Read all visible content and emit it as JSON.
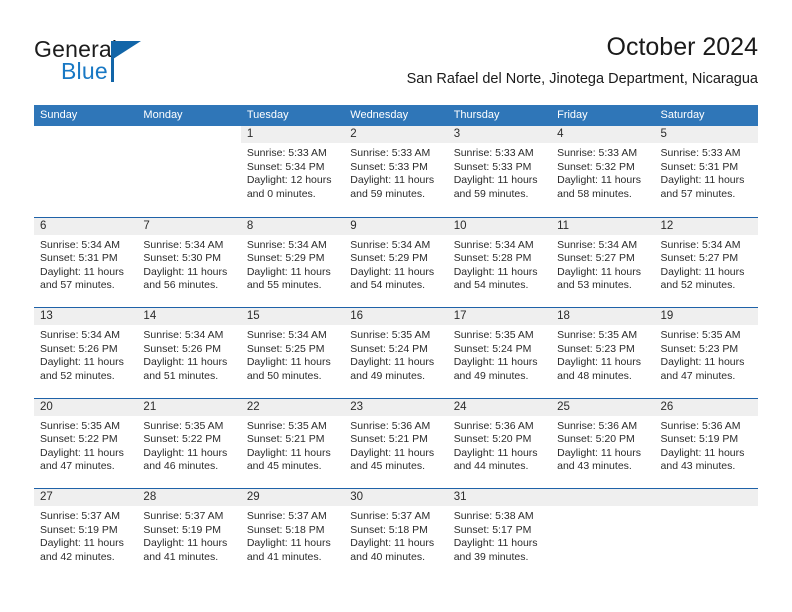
{
  "brand": {
    "word_one": "General",
    "word_two": "Blue",
    "accent_color": "#1265a8",
    "blue_text_color": "#1878c4"
  },
  "header": {
    "title": "October 2024",
    "subtitle": "San Rafael del Norte, Jinotega Department, Nicaragua"
  },
  "calendar": {
    "header_bg": "#2f76b8",
    "daynum_bg": "#efefef",
    "separator_color": "#1f62a8",
    "weekdays": [
      "Sunday",
      "Monday",
      "Tuesday",
      "Wednesday",
      "Thursday",
      "Friday",
      "Saturday"
    ],
    "weeks": [
      [
        {
          "day": "",
          "empty": true,
          "blank": true,
          "lines": []
        },
        {
          "day": "",
          "empty": true,
          "blank": true,
          "lines": []
        },
        {
          "day": "1",
          "lines": [
            "Sunrise: 5:33 AM",
            "Sunset: 5:34 PM",
            "Daylight: 12 hours",
            "and 0 minutes."
          ]
        },
        {
          "day": "2",
          "lines": [
            "Sunrise: 5:33 AM",
            "Sunset: 5:33 PM",
            "Daylight: 11 hours",
            "and 59 minutes."
          ]
        },
        {
          "day": "3",
          "lines": [
            "Sunrise: 5:33 AM",
            "Sunset: 5:33 PM",
            "Daylight: 11 hours",
            "and 59 minutes."
          ]
        },
        {
          "day": "4",
          "lines": [
            "Sunrise: 5:33 AM",
            "Sunset: 5:32 PM",
            "Daylight: 11 hours",
            "and 58 minutes."
          ]
        },
        {
          "day": "5",
          "lines": [
            "Sunrise: 5:33 AM",
            "Sunset: 5:31 PM",
            "Daylight: 11 hours",
            "and 57 minutes."
          ]
        }
      ],
      [
        {
          "day": "6",
          "lines": [
            "Sunrise: 5:34 AM",
            "Sunset: 5:31 PM",
            "Daylight: 11 hours",
            "and 57 minutes."
          ]
        },
        {
          "day": "7",
          "lines": [
            "Sunrise: 5:34 AM",
            "Sunset: 5:30 PM",
            "Daylight: 11 hours",
            "and 56 minutes."
          ]
        },
        {
          "day": "8",
          "lines": [
            "Sunrise: 5:34 AM",
            "Sunset: 5:29 PM",
            "Daylight: 11 hours",
            "and 55 minutes."
          ]
        },
        {
          "day": "9",
          "lines": [
            "Sunrise: 5:34 AM",
            "Sunset: 5:29 PM",
            "Daylight: 11 hours",
            "and 54 minutes."
          ]
        },
        {
          "day": "10",
          "lines": [
            "Sunrise: 5:34 AM",
            "Sunset: 5:28 PM",
            "Daylight: 11 hours",
            "and 54 minutes."
          ]
        },
        {
          "day": "11",
          "lines": [
            "Sunrise: 5:34 AM",
            "Sunset: 5:27 PM",
            "Daylight: 11 hours",
            "and 53 minutes."
          ]
        },
        {
          "day": "12",
          "lines": [
            "Sunrise: 5:34 AM",
            "Sunset: 5:27 PM",
            "Daylight: 11 hours",
            "and 52 minutes."
          ]
        }
      ],
      [
        {
          "day": "13",
          "lines": [
            "Sunrise: 5:34 AM",
            "Sunset: 5:26 PM",
            "Daylight: 11 hours",
            "and 52 minutes."
          ]
        },
        {
          "day": "14",
          "lines": [
            "Sunrise: 5:34 AM",
            "Sunset: 5:26 PM",
            "Daylight: 11 hours",
            "and 51 minutes."
          ]
        },
        {
          "day": "15",
          "lines": [
            "Sunrise: 5:34 AM",
            "Sunset: 5:25 PM",
            "Daylight: 11 hours",
            "and 50 minutes."
          ]
        },
        {
          "day": "16",
          "lines": [
            "Sunrise: 5:35 AM",
            "Sunset: 5:24 PM",
            "Daylight: 11 hours",
            "and 49 minutes."
          ]
        },
        {
          "day": "17",
          "lines": [
            "Sunrise: 5:35 AM",
            "Sunset: 5:24 PM",
            "Daylight: 11 hours",
            "and 49 minutes."
          ]
        },
        {
          "day": "18",
          "lines": [
            "Sunrise: 5:35 AM",
            "Sunset: 5:23 PM",
            "Daylight: 11 hours",
            "and 48 minutes."
          ]
        },
        {
          "day": "19",
          "lines": [
            "Sunrise: 5:35 AM",
            "Sunset: 5:23 PM",
            "Daylight: 11 hours",
            "and 47 minutes."
          ]
        }
      ],
      [
        {
          "day": "20",
          "lines": [
            "Sunrise: 5:35 AM",
            "Sunset: 5:22 PM",
            "Daylight: 11 hours",
            "and 47 minutes."
          ]
        },
        {
          "day": "21",
          "lines": [
            "Sunrise: 5:35 AM",
            "Sunset: 5:22 PM",
            "Daylight: 11 hours",
            "and 46 minutes."
          ]
        },
        {
          "day": "22",
          "lines": [
            "Sunrise: 5:35 AM",
            "Sunset: 5:21 PM",
            "Daylight: 11 hours",
            "and 45 minutes."
          ]
        },
        {
          "day": "23",
          "lines": [
            "Sunrise: 5:36 AM",
            "Sunset: 5:21 PM",
            "Daylight: 11 hours",
            "and 45 minutes."
          ]
        },
        {
          "day": "24",
          "lines": [
            "Sunrise: 5:36 AM",
            "Sunset: 5:20 PM",
            "Daylight: 11 hours",
            "and 44 minutes."
          ]
        },
        {
          "day": "25",
          "lines": [
            "Sunrise: 5:36 AM",
            "Sunset: 5:20 PM",
            "Daylight: 11 hours",
            "and 43 minutes."
          ]
        },
        {
          "day": "26",
          "lines": [
            "Sunrise: 5:36 AM",
            "Sunset: 5:19 PM",
            "Daylight: 11 hours",
            "and 43 minutes."
          ]
        }
      ],
      [
        {
          "day": "27",
          "lines": [
            "Sunrise: 5:37 AM",
            "Sunset: 5:19 PM",
            "Daylight: 11 hours",
            "and 42 minutes."
          ]
        },
        {
          "day": "28",
          "lines": [
            "Sunrise: 5:37 AM",
            "Sunset: 5:19 PM",
            "Daylight: 11 hours",
            "and 41 minutes."
          ]
        },
        {
          "day": "29",
          "lines": [
            "Sunrise: 5:37 AM",
            "Sunset: 5:18 PM",
            "Daylight: 11 hours",
            "and 41 minutes."
          ]
        },
        {
          "day": "30",
          "lines": [
            "Sunrise: 5:37 AM",
            "Sunset: 5:18 PM",
            "Daylight: 11 hours",
            "and 40 minutes."
          ]
        },
        {
          "day": "31",
          "lines": [
            "Sunrise: 5:38 AM",
            "Sunset: 5:17 PM",
            "Daylight: 11 hours",
            "and 39 minutes."
          ]
        },
        {
          "day": "",
          "empty": true,
          "lines": []
        },
        {
          "day": "",
          "empty": true,
          "lines": []
        }
      ]
    ]
  }
}
